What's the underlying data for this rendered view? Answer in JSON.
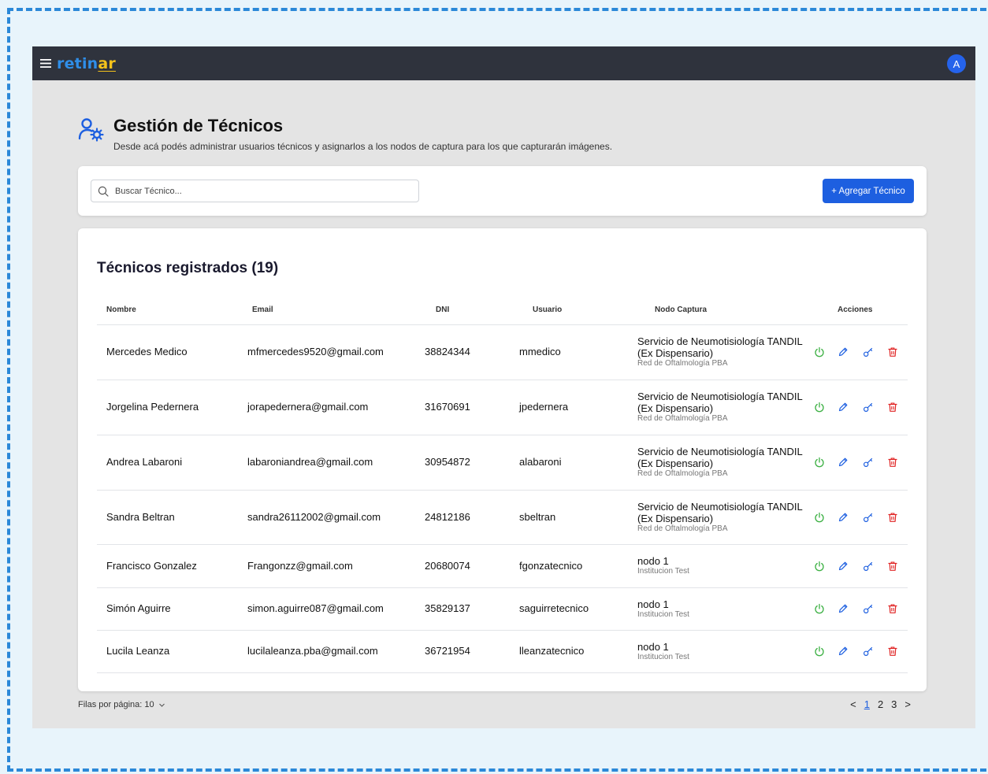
{
  "app": {
    "logo_a": "retin",
    "logo_b": "ar",
    "avatar": "A"
  },
  "page": {
    "title": "Gestión de Técnicos",
    "subtitle": "Desde acá podés administrar usuarios técnicos y asignarlos a los nodos de captura para los que capturarán imágenes."
  },
  "search": {
    "placeholder": "Buscar Técnico..."
  },
  "add_button": "+ Agregar Técnico",
  "table": {
    "heading": "Técnicos registrados (19)",
    "columns": [
      "Nombre",
      "Email",
      "DNI",
      "Usuario",
      "Nodo Captura",
      "Acciones"
    ],
    "rows": [
      {
        "name": "Mercedes Medico",
        "email": "mfmercedes9520@gmail.com",
        "dni": "38824344",
        "user": "mmedico",
        "node_l1": "Servicio de Neumotisiología TANDIL",
        "node_l2": "(Ex Dispensario)",
        "node_org": "Red de Oftalmología PBA"
      },
      {
        "name": "Jorgelina Pedernera",
        "email": "jorapedernera@gmail.com",
        "dni": "31670691",
        "user": "jpedernera",
        "node_l1": "Servicio de Neumotisiología TANDIL",
        "node_l2": "(Ex Dispensario)",
        "node_org": "Red de Oftalmología PBA"
      },
      {
        "name": "Andrea Labaroni",
        "email": "labaroniandrea@gmail.com",
        "dni": "30954872",
        "user": "alabaroni",
        "node_l1": "Servicio de Neumotisiología TANDIL",
        "node_l2": "(Ex Dispensario)",
        "node_org": "Red de Oftalmología PBA"
      },
      {
        "name": "Sandra Beltran",
        "email": "sandra26112002@gmail.com",
        "dni": "24812186",
        "user": "sbeltran",
        "node_l1": "Servicio de Neumotisiología TANDIL",
        "node_l2": "(Ex Dispensario)",
        "node_org": "Red de Oftalmología PBA"
      },
      {
        "name": "Francisco Gonzalez",
        "email": "Frangonzz@gmail.com",
        "dni": "20680074",
        "user": "fgonzatecnico",
        "node_l1": "nodo 1",
        "node_l2": "",
        "node_org": "Institucion Test"
      },
      {
        "name": "Simón Aguirre",
        "email": "simon.aguirre087@gmail.com",
        "dni": "35829137",
        "user": "saguirretecnico",
        "node_l1": "nodo 1",
        "node_l2": "",
        "node_org": "Institucion Test"
      },
      {
        "name": "Lucila Leanza",
        "email": "lucilaleanza.pba@gmail.com",
        "dni": "36721954",
        "user": "lleanzatecnico",
        "node_l1": "nodo 1",
        "node_l2": "",
        "node_org": "Institucion Test"
      }
    ]
  },
  "pagination": {
    "rows_label": "Filas por página:",
    "rows_value": "10",
    "prev": "<",
    "pages": [
      "1",
      "2",
      "3"
    ],
    "next": ">"
  },
  "colors": {
    "topbar": "#2f333d",
    "primary": "#1d5fe0",
    "power": "#3cb043",
    "delete": "#e02424"
  }
}
